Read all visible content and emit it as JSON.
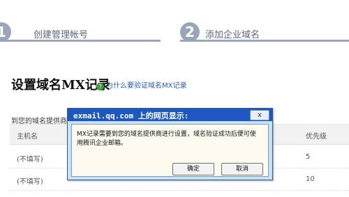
{
  "steps": [
    {
      "number": "1",
      "label": "创建管理帐号"
    },
    {
      "number": "2",
      "label": "添加企业域名"
    }
  ],
  "section": {
    "title": "设置域名MX记录",
    "help_link": "为什么要验证域名MX记录",
    "help_icon": "question-icon"
  },
  "notice": "到您的域名提供商",
  "table": {
    "headers": {
      "host": "主机名",
      "priority": "优先级"
    },
    "rows": [
      {
        "host": "(不填写)",
        "priority": "5"
      },
      {
        "host": "(不填写)",
        "priority": "10"
      }
    ]
  },
  "dialog": {
    "title": "exmail.qq.com 上的网页显示:",
    "close_label": "x",
    "message": "MX记录需要到您的域名提供商进行设置，域名验证成功后便可使用腾讯企业邮箱。",
    "ok_label": "确定",
    "cancel_label": "取消"
  },
  "colors": {
    "step_accent": "#9aa6b8",
    "dialog_titlebar": "#1e57c0",
    "link": "#2a57a5"
  }
}
